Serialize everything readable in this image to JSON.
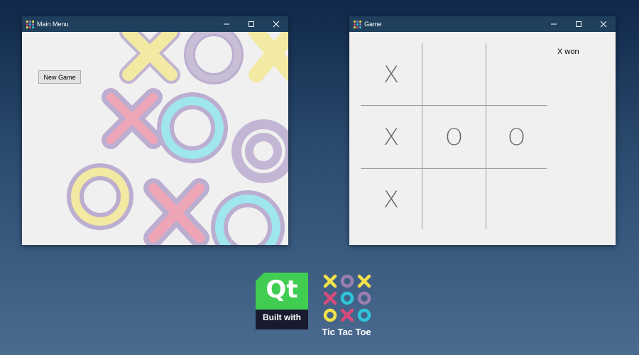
{
  "windows": {
    "main_menu": {
      "title": "Main Menu",
      "new_game_label": "New Game"
    },
    "game": {
      "title": "Game",
      "status": "X won",
      "board": [
        [
          "X",
          "",
          ""
        ],
        [
          "X",
          "O",
          "O"
        ],
        [
          "X",
          "",
          ""
        ]
      ]
    }
  },
  "window_controls": {
    "minimize": "–",
    "maximize": "☐",
    "close": "✕"
  },
  "branding": {
    "qt_wordmark": "Qt",
    "qt_caption": "Built with",
    "app_name": "Tic Tac Toe"
  },
  "colors": {
    "titlebar": "#1f3f5c",
    "qt_green": "#41cd52",
    "x_yellow": "#f2e24a",
    "o_purple": "#9b7fb0",
    "x_pink": "#d94a7a",
    "o_cyan": "#2ec5d8"
  },
  "icons": [
    "app-icon",
    "minimize-icon",
    "maximize-icon",
    "close-icon",
    "qt-logo",
    "tic-tac-toe-logo"
  ]
}
